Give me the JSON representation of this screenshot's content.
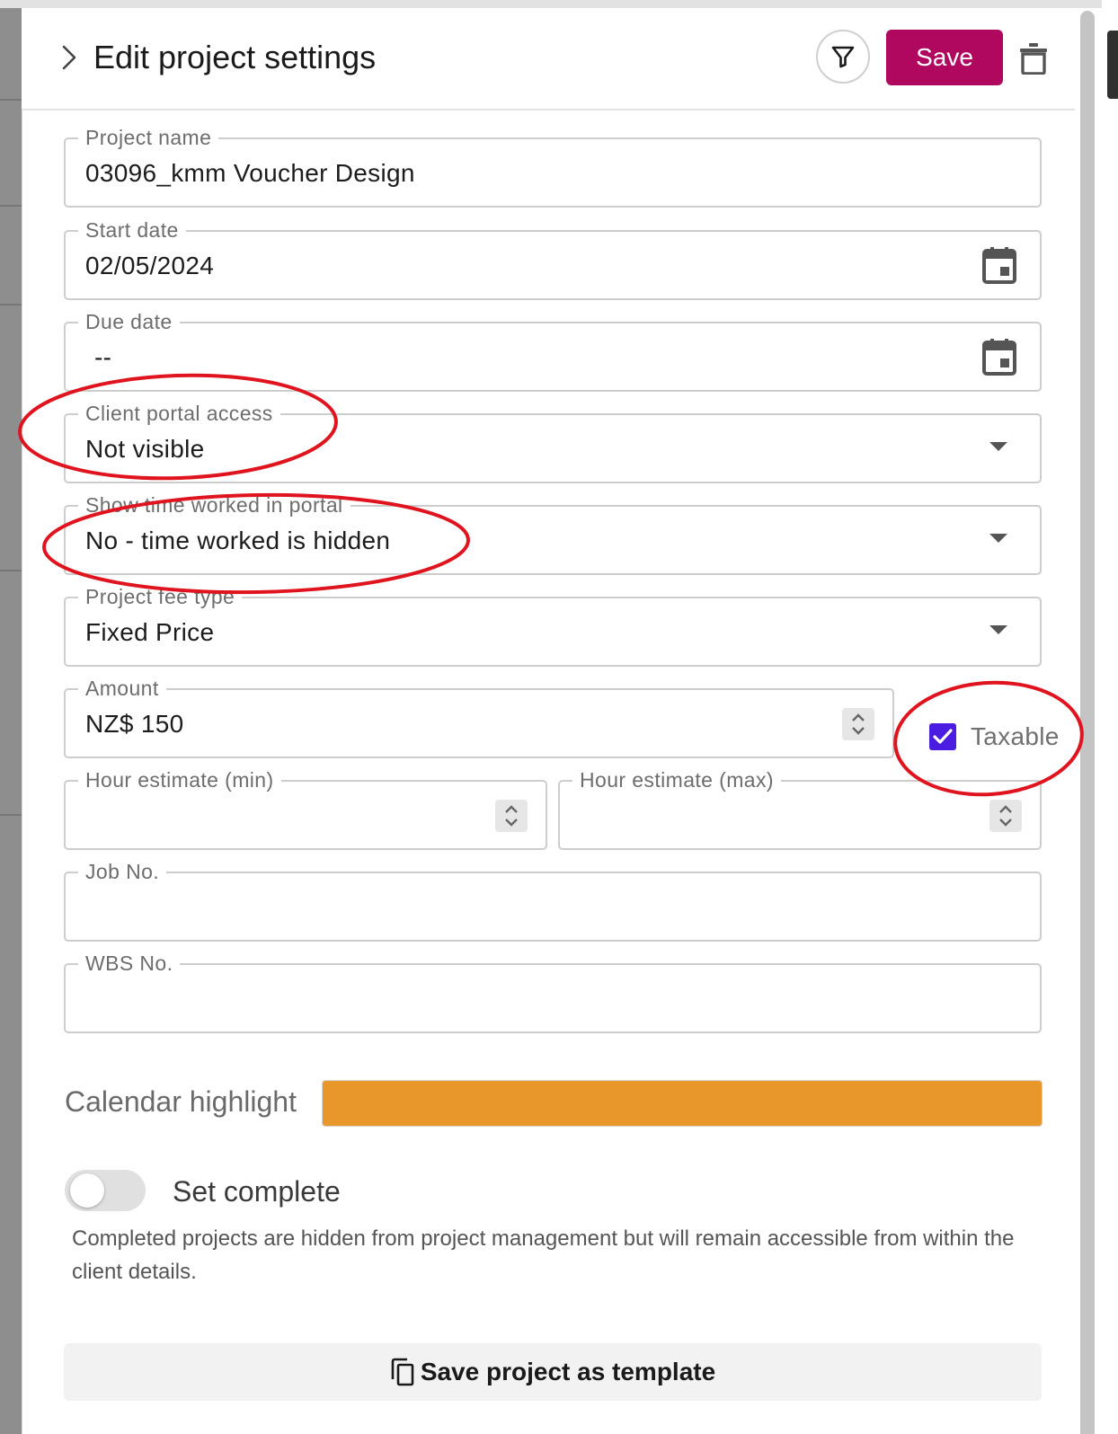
{
  "header": {
    "title": "Edit project settings",
    "save_label": "Save"
  },
  "form": {
    "project_name": {
      "label": "Project name",
      "value": "03096_kmm Voucher Design"
    },
    "start_date": {
      "label": "Start date",
      "value": "02/05/2024"
    },
    "due_date": {
      "label": "Due date",
      "value": "--"
    },
    "client_portal_access": {
      "label": "Client portal access",
      "value": "Not visible"
    },
    "show_time_worked": {
      "label": "Show time worked in portal",
      "value": "No - time worked is hidden"
    },
    "fee_type": {
      "label": "Project fee type",
      "value": "Fixed Price"
    },
    "amount": {
      "label": "Amount",
      "value": "NZ$ 150"
    },
    "taxable": {
      "label": "Taxable",
      "checked": true
    },
    "hour_min": {
      "label": "Hour estimate (min)",
      "value": ""
    },
    "hour_max": {
      "label": "Hour estimate (max)",
      "value": ""
    },
    "job_no": {
      "label": "Job No.",
      "value": ""
    },
    "wbs_no": {
      "label": "WBS No.",
      "value": ""
    }
  },
  "calendar_highlight": {
    "label": "Calendar highlight",
    "color": "#e8982a"
  },
  "set_complete": {
    "label": "Set complete",
    "on": false,
    "helper": "Completed projects are hidden from project management but will remain accessible from within the client details."
  },
  "template_button": {
    "label": "Save project as template"
  },
  "colors": {
    "accent": "#b0075f",
    "checkbox": "#4a1de0",
    "annotation": "#e0141e"
  },
  "icons": [
    "chevron-right-icon",
    "filter-icon",
    "trash-icon",
    "calendar-icon",
    "dropdown-caret-icon",
    "stepper-icon",
    "checkmark-icon",
    "copy-icon"
  ]
}
